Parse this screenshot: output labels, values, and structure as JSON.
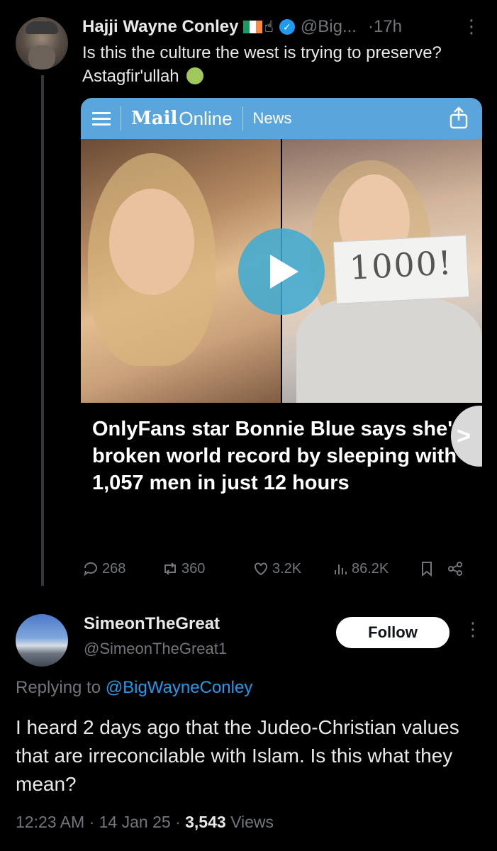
{
  "original_tweet": {
    "author_name": "Hajji Wayne Conley",
    "handle": "@Big...",
    "time": "·17h",
    "text": "Is this the culture the west is trying to preserve? Astagfir'ullah",
    "emoji_icon": "nauseated-face-icon"
  },
  "card": {
    "brand_mail": "Mail",
    "brand_online": "Online",
    "section": "News",
    "image_text": "1000!",
    "headline": "OnlyFans star Bonnie Blue says she's broken world record by sleeping with 1,057 men in just 12 hours",
    "header_color": "#5aa6dc"
  },
  "actions": {
    "replies": "268",
    "reposts": "360",
    "likes": "3.2K",
    "views": "86.2K"
  },
  "reply": {
    "author_name": "SimeonTheGreat",
    "handle": "@SimeonTheGreat1",
    "follow_label": "Follow",
    "replying_prefix": "Replying to ",
    "replying_to": "@BigWayneConley",
    "text": "I heard 2 days ago that the Judeo-Christian values that are irreconcilable with Islam. Is this what they mean?",
    "time": "12:23 AM",
    "date": "14 Jan 25",
    "views_count": "3,543",
    "views_label": "Views"
  },
  "colors": {
    "background": "#000000",
    "link": "#1d9bf0",
    "muted": "#71767b"
  }
}
